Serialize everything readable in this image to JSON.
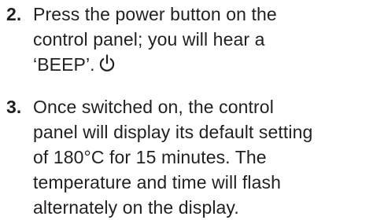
{
  "steps": [
    {
      "number": "2.",
      "lines": [
        "Press the power button on the",
        "control panel; you will hear a",
        "‘BEEP’."
      ],
      "icon": "power-icon"
    },
    {
      "number": "3.",
      "lines": [
        "Once switched on, the control",
        "panel will display its default setting",
        "of 180°C for 15 minutes. The",
        "temperature and time will flash",
        "alternately on the display."
      ]
    }
  ]
}
